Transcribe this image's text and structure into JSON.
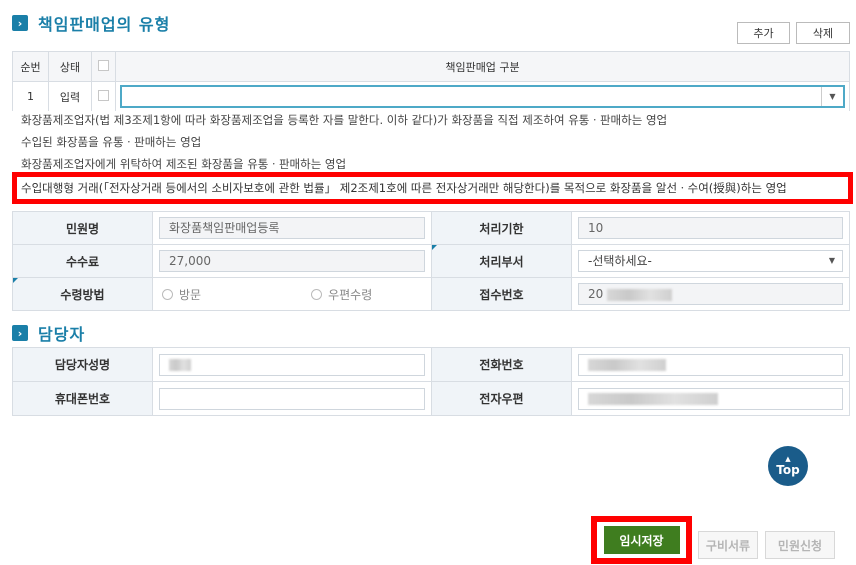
{
  "section1": {
    "title": "책임판매업의 유형"
  },
  "toolbar": {
    "add_label": "추가",
    "delete_label": "삭제"
  },
  "list": {
    "headers": {
      "seq": "순번",
      "status": "상태",
      "type": "책임판매업 구분"
    },
    "row": {
      "seq": "1",
      "status": "입력",
      "value": ""
    }
  },
  "dropdown_options": [
    "화장품제조업자(법 제3조제1항에 따라 화장품제조업을 등록한 자를 말한다. 이하 같다)가 화장품을 직접 제조하여 유통ㆍ판매하는 영업",
    "수입된 화장품을 유통ㆍ판매하는 영업",
    "화장품제조업자에게 위탁하여 제조된 화장품을 유통ㆍ판매하는 영업",
    "수입대행형 거래(「전자상거래 등에서의 소비자보호에 관한 법률」 제2조제1호에 따른 전자상거래만 해당한다)를 목적으로 화장품을 알선ㆍ수여(授與)하는 영업"
  ],
  "info": {
    "petition_name_label": "민원명",
    "petition_name_value": "화장품책임판매업등록",
    "deadline_label": "처리기한",
    "deadline_value": "10",
    "fee_label": "수수료",
    "fee_value": "27,000",
    "dept_label": "처리부서",
    "dept_value": "-선택하세요-",
    "receive_label": "수령방법",
    "receive_visit": "방문",
    "receive_mail": "우편수령",
    "receipt_label": "접수번호",
    "receipt_value": "20"
  },
  "section2": {
    "title": "담당자"
  },
  "contact": {
    "name_label": "담당자성명",
    "phone_label": "전화번호",
    "mobile_label": "휴대폰번호",
    "email_label": "전자우편"
  },
  "top_button": {
    "label": "Top"
  },
  "actions": {
    "temp_save": "임시저장",
    "documents": "구비서류",
    "apply": "민원신청"
  },
  "colors": {
    "accent": "#1a7fa8",
    "save_green": "#3f7d1f",
    "highlight_red": "#ff0000"
  }
}
